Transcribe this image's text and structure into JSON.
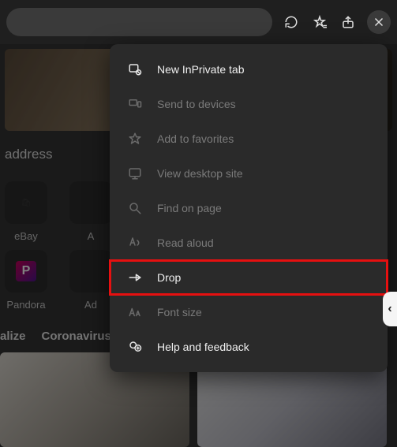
{
  "toolbar": {
    "icons": {
      "refresh": "refresh",
      "favorites": "favorites",
      "share": "share",
      "close": "close"
    }
  },
  "background": {
    "address_label": "address",
    "tiles": [
      {
        "name": "eBay",
        "extra": ""
      },
      {
        "name": "A",
        "extra": ""
      },
      {
        "name": "Pandora",
        "extra": ""
      },
      {
        "name": "Ad",
        "extra": ""
      }
    ],
    "topics": [
      "alize",
      "Coronavirus"
    ]
  },
  "menu": {
    "items": [
      {
        "id": "new-inprivate",
        "label": "New InPrivate tab",
        "enabled": true,
        "highlight": false
      },
      {
        "id": "send-devices",
        "label": "Send to devices",
        "enabled": false,
        "highlight": false
      },
      {
        "id": "add-fav",
        "label": "Add to favorites",
        "enabled": false,
        "highlight": false
      },
      {
        "id": "desktop-site",
        "label": "View desktop site",
        "enabled": false,
        "highlight": false
      },
      {
        "id": "find-page",
        "label": "Find on page",
        "enabled": false,
        "highlight": false
      },
      {
        "id": "read-aloud",
        "label": "Read aloud",
        "enabled": false,
        "highlight": false
      },
      {
        "id": "drop",
        "label": "Drop",
        "enabled": true,
        "highlight": true
      },
      {
        "id": "font-size",
        "label": "Font size",
        "enabled": false,
        "highlight": false
      },
      {
        "id": "help",
        "label": "Help and feedback",
        "enabled": true,
        "highlight": false
      }
    ]
  }
}
